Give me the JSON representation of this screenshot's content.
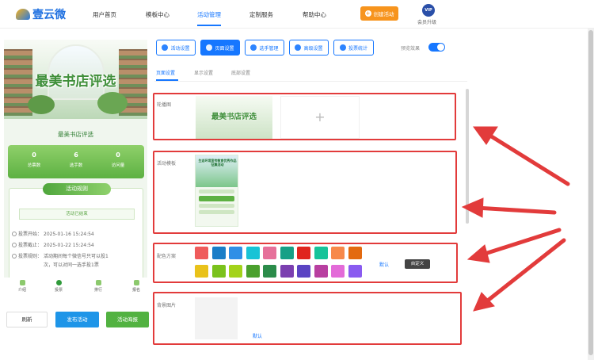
{
  "nav": {
    "brand": "壹云微",
    "items": [
      "用户首页",
      "模板中心",
      "活动管理",
      "定制服务",
      "帮助中心"
    ],
    "active_index": 2,
    "create_label": "创建活动",
    "vip_badge": "VIP",
    "vip_label": "会员升级",
    "accent_color": "#1677ff",
    "create_color": "#f7941d"
  },
  "preview": {
    "banner_title": "最美书店评选",
    "activity_title": "最美书店评选",
    "stats": [
      {
        "value": "0",
        "label": "总票数"
      },
      {
        "value": "6",
        "label": "选手数"
      },
      {
        "value": "0",
        "label": "访问量"
      }
    ],
    "rules_title": "活动规则",
    "status": "活动已结束",
    "rules": [
      {
        "label": "投票开始：",
        "value": "2025-01-16 15:24:54"
      },
      {
        "label": "投票截止：",
        "value": "2025-01-22 15:24:54"
      },
      {
        "label": "投票规则：",
        "value": "活动期间每个微信号只可以投1",
        "value2": "次，可以对同一选手投1票"
      }
    ],
    "tabs": [
      "介绍",
      "投票",
      "排行",
      "报名"
    ]
  },
  "actions": {
    "refresh": "刷新",
    "publish": "发布活动",
    "poster": "活动海报"
  },
  "settings": {
    "buttons": [
      "活动设置",
      "页面设置",
      "选手管理",
      "高级设置",
      "投票统计"
    ],
    "active_button": 1,
    "preview_toggle_label": "预览效果",
    "preview_toggle_on": true,
    "subtabs": [
      "页面设置",
      "显示设置",
      "底部设置"
    ],
    "active_subtab": 0,
    "carousel_label": "轮播图",
    "carousel_image_text": "最美书店评选",
    "upload_plus": "+",
    "template_label": "活动模板",
    "template_text": "生态环境宣传教育优秀作品征集活动",
    "scheme_label": "配色方案",
    "swatches_row1": [
      "#ef5b5b",
      "#1a7ec8",
      "#2f8fe6",
      "#19c3d6",
      "#e6709a",
      "#16a086",
      "#e0251e",
      "#16c39a",
      "#f7894a",
      "#e36a10"
    ],
    "swatches_row2": [
      "#e9c21a",
      "#7ac21c",
      "#a3d31a",
      "#4aa02d",
      "#2b8c4a",
      "#7b3fb0",
      "#5b44c3",
      "#b83fa0",
      "#e36bd8",
      "#8a5bf0"
    ],
    "scheme_default": "默认",
    "scheme_custom": "自定义",
    "bg_label": "背景图片",
    "bg_default": "默认"
  }
}
